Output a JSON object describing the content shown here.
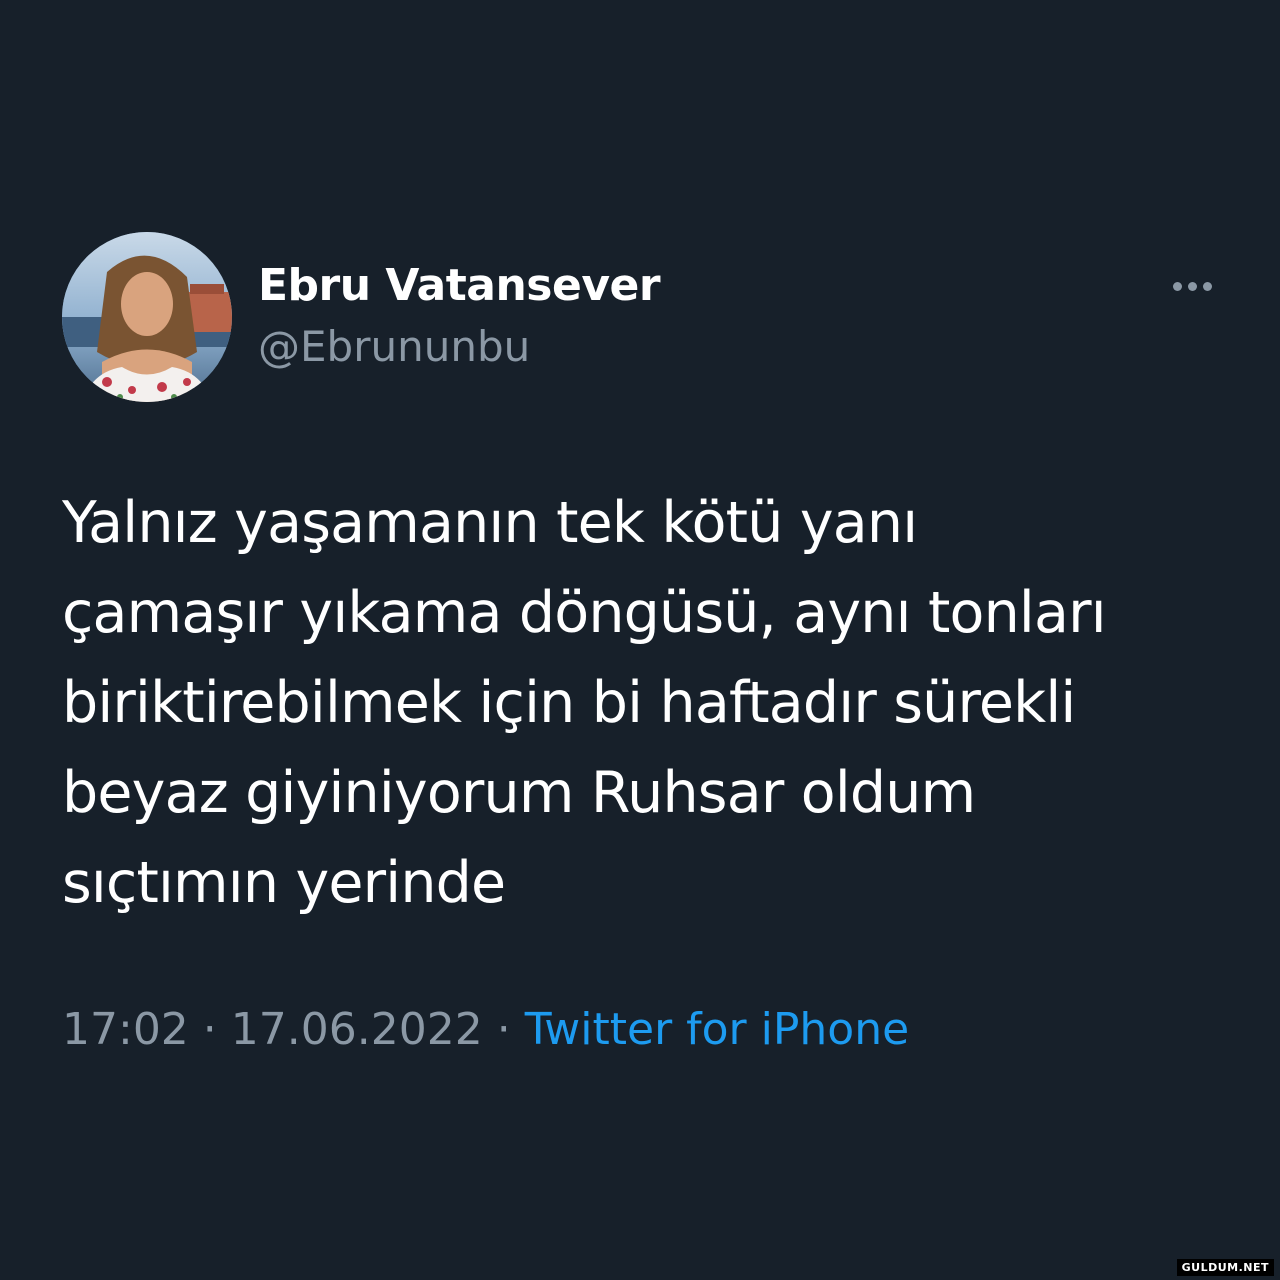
{
  "colors": {
    "background": "#17202a",
    "text_primary": "#ffffff",
    "text_secondary": "#8b98a5",
    "link": "#1d9bf0"
  },
  "tweet": {
    "author": {
      "display_name": "Ebru Vatansever",
      "handle": "@Ebrununbu",
      "avatar_icon": "profile-photo"
    },
    "more_icon": "ellipsis-icon",
    "text": "Yalnız yaşamanın tek kötü yanı\nçamaşır yıkama döngüsü, aynı tonları\nbiriktirebilmek için bi haftadır sürekli\nbeyaz giyiniyorum Ruhsar oldum\nsıçtımın yerinde",
    "time": "17:02",
    "separator": " · ",
    "date": "17.06.2022",
    "source": "Twitter for iPhone"
  },
  "watermark": "GULDUM.NET"
}
